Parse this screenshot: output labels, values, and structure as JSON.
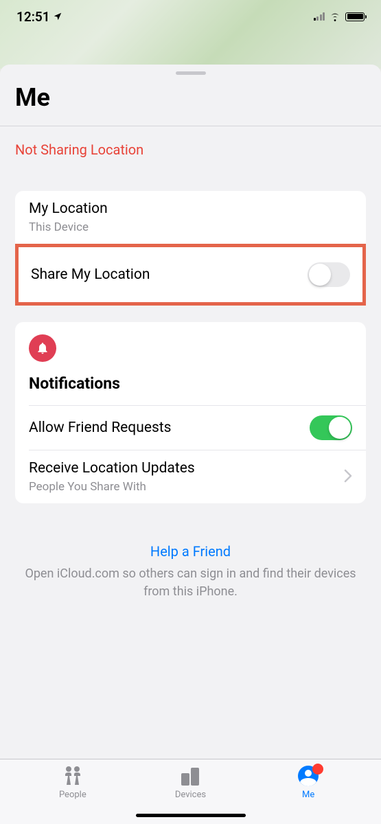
{
  "status_bar": {
    "time": "12:51"
  },
  "sheet": {
    "title": "Me",
    "sharing_status": "Not Sharing Location"
  },
  "location_card": {
    "my_location_title": "My Location",
    "my_location_sub": "This Device",
    "share_title": "Share My Location",
    "share_toggle_on": false
  },
  "notifications_card": {
    "header": "Notifications",
    "allow_friend_title": "Allow Friend Requests",
    "allow_friend_toggle_on": true,
    "receive_updates_title": "Receive Location Updates",
    "receive_updates_sub": "People You Share With"
  },
  "help": {
    "title": "Help a Friend",
    "subtitle": "Open iCloud.com so others can sign in and find their devices from this iPhone."
  },
  "tabs": {
    "people": "People",
    "devices": "Devices",
    "me": "Me"
  }
}
